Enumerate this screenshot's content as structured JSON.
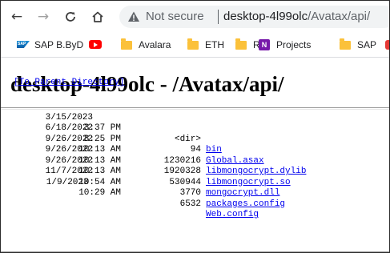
{
  "browser": {
    "not_secure": "Not secure",
    "url_host": "desktop-4l99olc",
    "url_path": "/Avatax/api/",
    "icons": {
      "back": "arrow-left",
      "forward": "arrow-right",
      "reload": "reload",
      "home": "home",
      "security": "warning-triangle"
    }
  },
  "bookmarks": [
    {
      "label": "SAP B.ByD",
      "icon": "sap-logo"
    },
    {
      "label": "",
      "icon": "youtube-logo"
    },
    {
      "label": "Avalara",
      "icon": "folder"
    },
    {
      "label": "ETH",
      "icon": "folder"
    },
    {
      "label": "R",
      "icon": "folder"
    },
    {
      "label": "Projects",
      "icon": "onenote-logo"
    },
    {
      "label": "SAP",
      "icon": "folder"
    }
  ],
  "page": {
    "title": "desktop-4l99olc - /Avatax/api/",
    "parent_link": "[To Parent Directory]",
    "entries": [
      {
        "date": "3/15/2023",
        "time": "3:37 PM",
        "size": "<dir>",
        "name": "bin"
      },
      {
        "date": "6/18/2022",
        "time": "8:25 PM",
        "size": "94",
        "name": "Global.asax"
      },
      {
        "date": "9/26/2022",
        "time": "10:13 AM",
        "size": "1230216",
        "name": "libmongocrypt.dylib"
      },
      {
        "date": "9/26/2022",
        "time": "10:13 AM",
        "size": "1920328",
        "name": "libmongocrypt.so"
      },
      {
        "date": "9/26/2022",
        "time": "10:13 AM",
        "size": "530944",
        "name": "mongocrypt.dll"
      },
      {
        "date": "11/7/2022",
        "time": "10:54 AM",
        "size": "3770",
        "name": "packages.config"
      },
      {
        "date": "1/9/2023",
        "time": "10:29 AM",
        "size": "6532",
        "name": "Web.config"
      }
    ]
  },
  "colors": {
    "link": "#0000ee",
    "folder": "#fbc13a",
    "omnibox_bg": "#f1f3f4"
  }
}
